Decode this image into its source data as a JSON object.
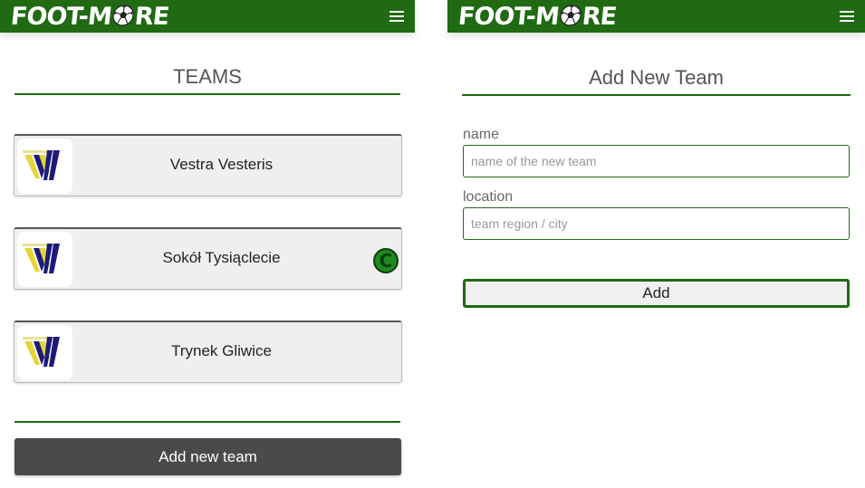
{
  "brand": {
    "logo_text_left": "FOOT-M",
    "logo_text_right": "RE",
    "color": "#1f6a12"
  },
  "teams_page": {
    "title": "TEAMS",
    "teams": [
      {
        "name": "Vestra Vesteris",
        "captain": false
      },
      {
        "name": "Sokół Tysiąclecie",
        "captain": true,
        "badge": "C"
      },
      {
        "name": "Trynek Gliwice",
        "captain": false
      }
    ],
    "add_button_label": "Add new team"
  },
  "add_team_page": {
    "title": "Add New Team",
    "fields": [
      {
        "label": "name",
        "placeholder": "name of the new team"
      },
      {
        "label": "location",
        "placeholder": "team region / city"
      }
    ],
    "submit_label": "Add"
  },
  "icons": {
    "menu": "hamburger-menu-icon",
    "team_logo": "team-logo-icon",
    "captain": "captain-badge-icon"
  }
}
